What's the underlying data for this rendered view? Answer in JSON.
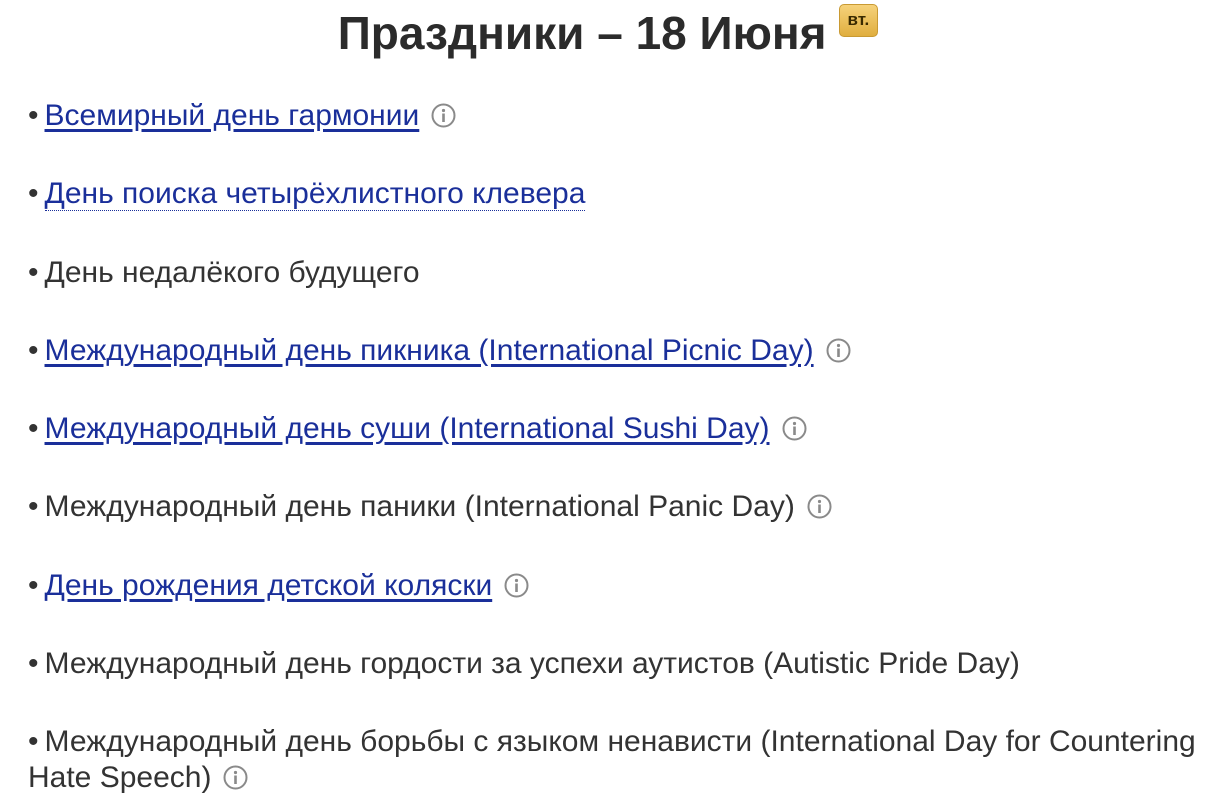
{
  "header": {
    "title": "Праздники – 18 Июня",
    "day_badge": "вт."
  },
  "holidays": [
    {
      "label": "Всемирный день гармонии",
      "link": true,
      "info": true
    },
    {
      "label": "День поиска четырёхлистного клевера",
      "link": true,
      "info": false
    },
    {
      "label": "День недалёкого будущего",
      "link": false,
      "info": false
    },
    {
      "label": "Международный день пикника (International Picnic Day)",
      "link": true,
      "info": true
    },
    {
      "label": "Международный день суши (International Sushi Day)",
      "link": true,
      "info": true
    },
    {
      "label": "Международный день паники (International Panic Day)",
      "link": false,
      "info": true
    },
    {
      "label": "День рождения детской коляски",
      "link": true,
      "info": true
    },
    {
      "label": "Международный день гордости за успехи аутистов (Autistic Pride Day)",
      "link": false,
      "info": false
    },
    {
      "label": "Международный день борьбы с языком ненависти (International Day for Countering Hate Speech)",
      "link": false,
      "info": true
    }
  ],
  "bullet": "•",
  "icons": {
    "info": "info-circle-icon"
  },
  "colors": {
    "link": "#1a2f9a",
    "text": "#333333",
    "badge": "#e8b84f",
    "icon": "#8a8a8a"
  }
}
